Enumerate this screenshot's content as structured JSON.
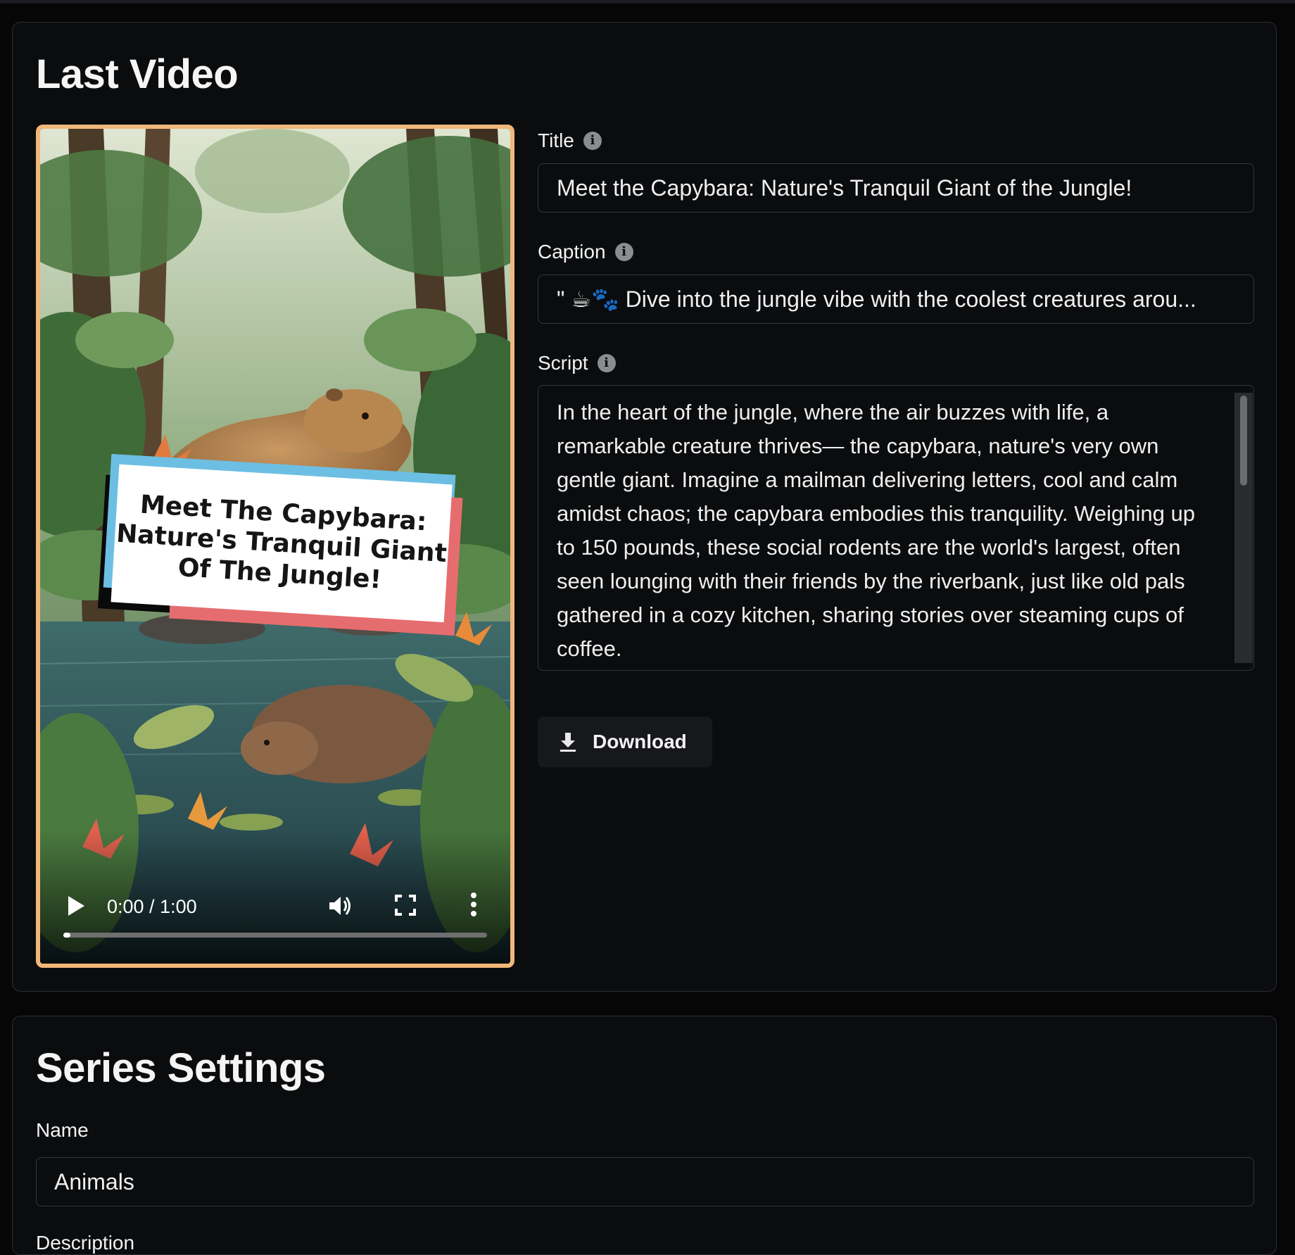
{
  "last_video": {
    "heading": "Last Video",
    "video": {
      "overlay_text": "Meet The Capybara:\nNature's Tranquil Giant\nOf The Jungle!",
      "time_display": "0:00 / 1:00",
      "progress": 0.0
    },
    "title_field": {
      "label": "Title",
      "value": "Meet the Capybara: Nature's Tranquil Giant of the Jungle!"
    },
    "caption_field": {
      "label": "Caption",
      "value": "\" ☕🐾 Dive into the jungle vibe with the coolest creatures arou..."
    },
    "script_field": {
      "label": "Script",
      "value": "In the heart of the jungle, where the air buzzes with life, a remarkable creature thrives— the capybara, nature's very own gentle giant. Imagine a mailman delivering letters, cool and calm amidst chaos; the capybara embodies this tranquility. Weighing up to 150 pounds, these social rodents are the world's largest, often seen lounging with their friends by the riverbank, just like old pals gathered in a cozy kitchen, sharing stories over steaming cups of coffee."
    },
    "download_label": "Download"
  },
  "series_settings": {
    "heading": "Series Settings",
    "name_field": {
      "label": "Name",
      "value": "Animals"
    },
    "description_label": "Description"
  },
  "colors": {
    "video_border": "#f0b77a",
    "background": "#060607",
    "card": "#0b0c0e"
  },
  "icons": [
    "info-icon",
    "play-icon",
    "volume-icon",
    "fullscreen-icon",
    "more-vertical-icon",
    "download-icon"
  ]
}
